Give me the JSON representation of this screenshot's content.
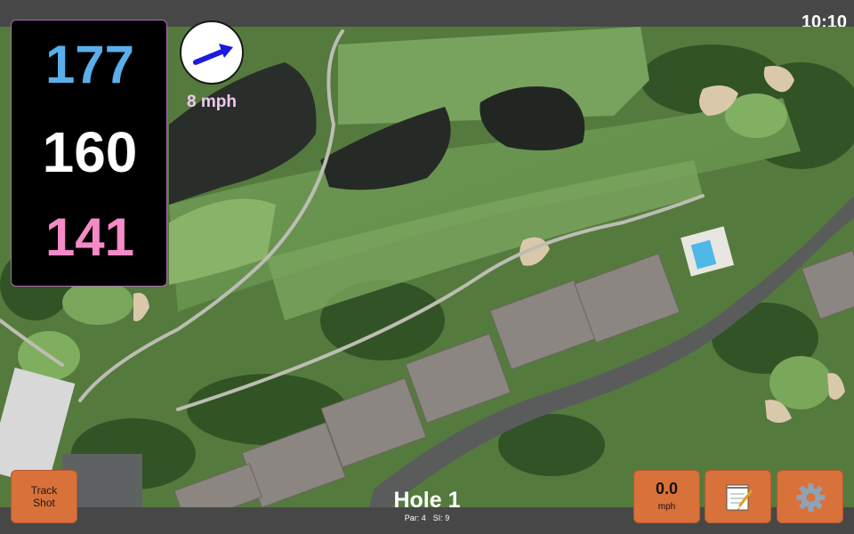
{
  "status": {
    "clock": "10:10"
  },
  "distances": {
    "back": "177",
    "middle": "160",
    "front": "141"
  },
  "wind": {
    "speed_label": "8 mph",
    "direction_icon": "arrow-icon"
  },
  "buttons": {
    "track_shot_label": "Track\nShot",
    "speed_value": "0.0",
    "speed_unit": "mph",
    "notes_icon": "notepad-icon",
    "settings_icon": "gear-icon"
  },
  "hole": {
    "title": "Hole 1",
    "par": "Par: 4",
    "stroke_index": "SI: 9"
  },
  "colors": {
    "back_distance": "#5aaeea",
    "middle_distance": "#ffffff",
    "front_distance": "#f48ac6",
    "button_orange": "#d9713a",
    "wind_text": "#f0c8f0"
  }
}
